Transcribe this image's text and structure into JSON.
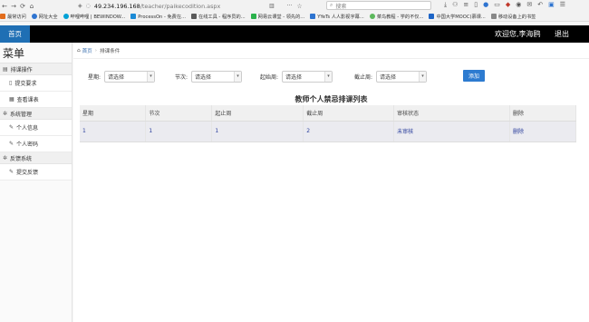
{
  "browser": {
    "url_host": "49.234.196.168",
    "url_path": "/teacher/paikecodition.aspx",
    "search_placeholder": "搜索",
    "more_label": "···",
    "bookmarks": [
      {
        "label": "最常访问",
        "color": "#e26d1d"
      },
      {
        "label": "网址大全",
        "color": "#2e74d0"
      },
      {
        "label": "哔哩哔哩 | BEWINDOW...",
        "color": "#00a1d6"
      },
      {
        "label": "ProcessOn - 免费在...",
        "color": "#1c8bd6"
      },
      {
        "label": "在线工具 - 程序员的...",
        "color": "#5a5a5a"
      },
      {
        "label": "网易云课堂 - 领先的...",
        "color": "#2bb24c"
      },
      {
        "label": "YYeTs 人人影视字幕...",
        "color": "#2e74d0"
      },
      {
        "label": "菜鸟教程 - 学的不仅...",
        "color": "#5cb85c"
      },
      {
        "label": "中国大学MOOC(慕课...",
        "color": "#1e65c7"
      },
      {
        "label": "移动设备上的书签",
        "color": "#888888"
      }
    ]
  },
  "header": {
    "home_tab": "首页",
    "welcome": "欢迎您,李海鸥",
    "logout": "退出"
  },
  "sidebar": {
    "title": "菜单",
    "groups": [
      {
        "label": "排课操作",
        "items": [
          "提交要求",
          "查看课表"
        ]
      },
      {
        "label": "系统管理",
        "items": [
          "个人信息",
          "个人密码"
        ]
      },
      {
        "label": "反馈系统",
        "items": [
          "提交反馈"
        ]
      }
    ]
  },
  "breadcrumb": {
    "home": "首页",
    "current": "排课条件"
  },
  "filters": [
    {
      "label": "星期:",
      "value": "请选择"
    },
    {
      "label": "节次:",
      "value": "请选择"
    },
    {
      "label": "起始周:",
      "value": "请选择"
    },
    {
      "label": "截止周:",
      "value": "请选择"
    }
  ],
  "add_button": "添加",
  "table": {
    "title": "教师个人禁忌排课列表",
    "headers": [
      "星期",
      "节次",
      "起止周",
      "截止周",
      "审核状态",
      "删除"
    ],
    "rows": [
      [
        "1",
        "1",
        "1",
        "2",
        "未审核",
        "删除"
      ]
    ]
  }
}
